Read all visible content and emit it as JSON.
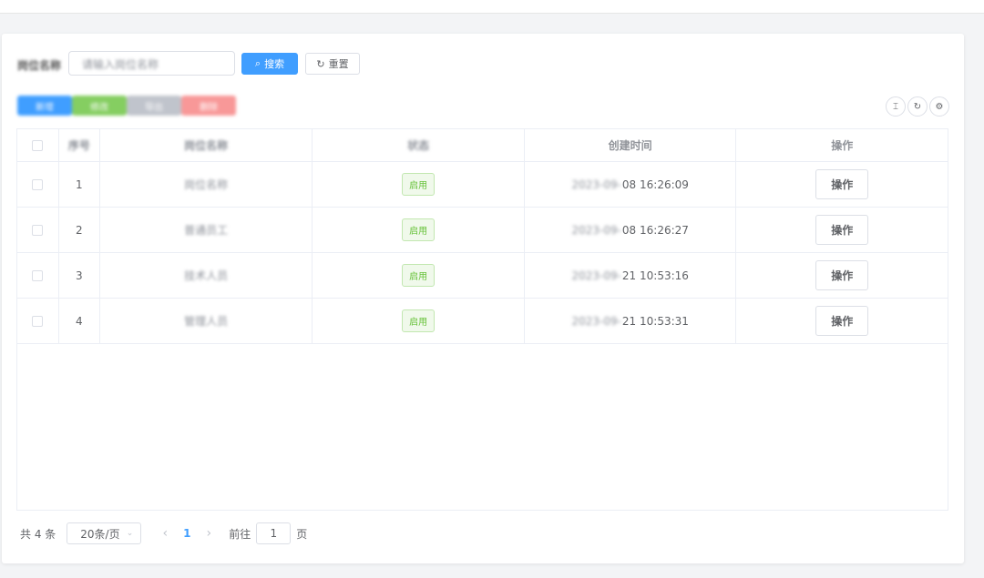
{
  "search": {
    "label": "岗位名称",
    "input_value": "请输入岗位名称",
    "search_label": "搜索",
    "reset_label": "重置"
  },
  "actions": {
    "add_label": "新增",
    "edit_label": "修改",
    "export_label": "导出",
    "delete_label": "删除",
    "colors": {
      "add": "#409eff",
      "edit": "#85ce61",
      "export": "#c0c4cc",
      "delete": "#f89898"
    }
  },
  "toolbar": {
    "icons": [
      "column-height-icon",
      "refresh-icon",
      "settings-icon"
    ],
    "glyphs": [
      "⌶",
      "↻",
      "⚙"
    ]
  },
  "table": {
    "headers": [
      "序号",
      "岗位名称",
      "状态",
      "创建时间",
      "操作"
    ],
    "rows": [
      {
        "index": "1",
        "name": "岗位名称",
        "status": "启用",
        "time_prefix": "2023-09-",
        "time_suffix": "08 16:26:09",
        "op": "操作"
      },
      {
        "index": "2",
        "name": "普通员工",
        "status": "启用",
        "time_prefix": "2023-09-",
        "time_suffix": "08 16:26:27",
        "op": "操作"
      },
      {
        "index": "3",
        "name": "技术人员",
        "status": "启用",
        "time_prefix": "2023-09-",
        "time_suffix": "21 10:53:16",
        "op": "操作"
      },
      {
        "index": "4",
        "name": "管理人员",
        "status": "启用",
        "time_prefix": "2023-09-",
        "time_suffix": "21 10:53:31",
        "op": "操作"
      }
    ]
  },
  "pagination": {
    "total": "共 4 条",
    "page_size": "20条/页",
    "current_page": "1",
    "goto_label": "前往",
    "goto_value": "1",
    "page_unit": "页"
  },
  "colors": {
    "primary": "#409eff",
    "success": "#67c23a"
  }
}
